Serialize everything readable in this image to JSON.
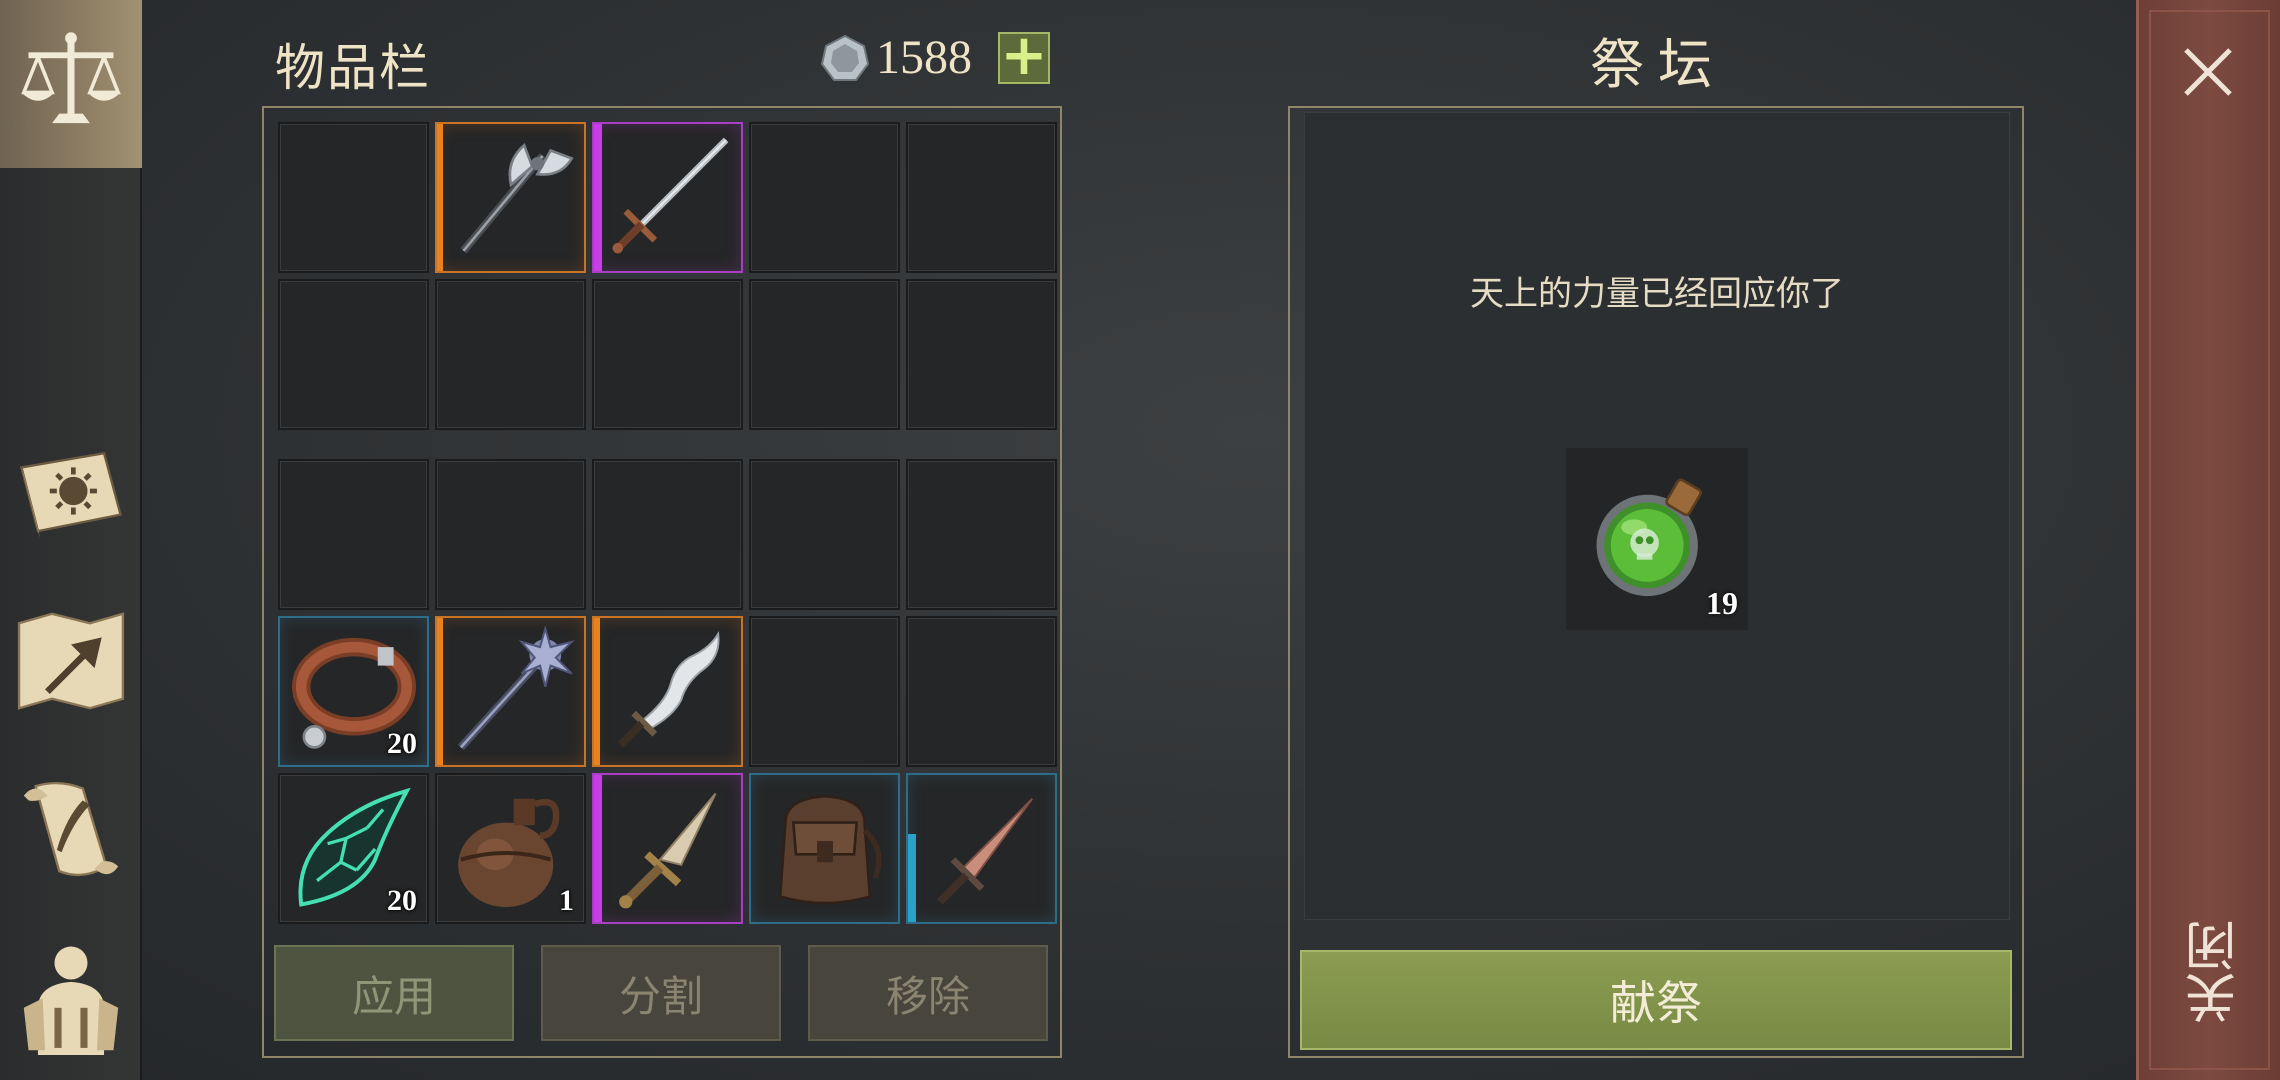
{
  "inventory": {
    "title": "物品栏",
    "currency": {
      "icon": "silver-coin-icon",
      "amount": "1588",
      "add_icon": "plus-icon"
    },
    "equip_slots": [
      {
        "item": null
      },
      {
        "item": "battle-axe-icon",
        "rarity": "orange"
      },
      {
        "item": "longsword-icon",
        "rarity": "purple"
      },
      {
        "item": null
      },
      {
        "item": null
      },
      {
        "item": null
      },
      {
        "item": null
      },
      {
        "item": null
      },
      {
        "item": null
      },
      {
        "item": null
      }
    ],
    "bag_slots": [
      {
        "item": null
      },
      {
        "item": null
      },
      {
        "item": null
      },
      {
        "item": null
      },
      {
        "item": null
      },
      {
        "item": "leather-collar-icon",
        "rarity": "blue",
        "qty": "20"
      },
      {
        "item": "ornate-mace-icon",
        "rarity": "orange"
      },
      {
        "item": "wavy-dagger-icon",
        "rarity": "orange"
      },
      {
        "item": null
      },
      {
        "item": null
      },
      {
        "item": "crystal-shard-icon",
        "qty": "20"
      },
      {
        "item": "clay-flask-icon",
        "qty": "1"
      },
      {
        "item": "bronze-dagger-icon",
        "rarity": "purple"
      },
      {
        "item": "backpack-icon",
        "rarity": "blue"
      },
      {
        "item": "copper-dagger-icon",
        "rarity": "blue",
        "durability": 0.6
      }
    ],
    "buttons": {
      "use": "应用",
      "split": "分割",
      "remove": "移除"
    }
  },
  "altar": {
    "title": "祭坛",
    "message": "天上的力量已经回应你了",
    "offering": {
      "item": "poison-potion-icon",
      "qty": "19"
    },
    "offer_button": "献祭"
  },
  "sidebar": {
    "items": [
      "scales-icon",
      "sun-book-icon",
      "map-arrow-icon",
      "scroll-quill-icon",
      "character-equipment-icon"
    ],
    "active": "scales-icon"
  },
  "close": {
    "label": "关闭",
    "icon": "close-icon"
  },
  "colors": {
    "rarity_orange": "#e8811f",
    "rarity_purple": "#c83ee6",
    "rarity_blue": "#2aa2c8",
    "offer_button": "#84954c",
    "close_strip": "#7a463d"
  }
}
